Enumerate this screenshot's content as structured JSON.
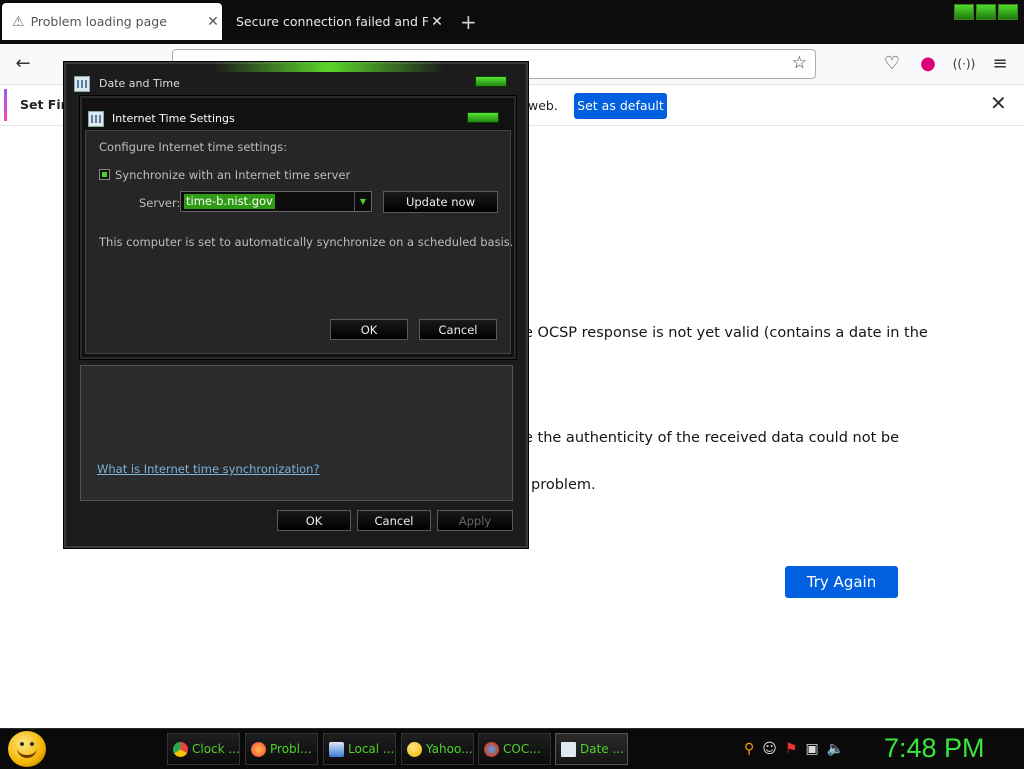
{
  "browser": {
    "tabs": [
      {
        "label": "Problem loading page",
        "active": true
      },
      {
        "label": "Secure connection failed and Firefo",
        "active": false
      }
    ],
    "new_tab_glyph": "+",
    "notification": {
      "text_start": "Set Fire",
      "text_end": "web.",
      "button": "Set as default"
    }
  },
  "error_page": {
    "line1": "e OCSP response is not yet valid (contains a date in the",
    "line2": "e the authenticity of the received data could not be",
    "line3": "problem.",
    "try_again": "Try Again"
  },
  "date_time_dialog": {
    "title": "Date and Time",
    "help_link": "What is Internet time synchronization?",
    "ok": "OK",
    "cancel": "Cancel",
    "apply": "Apply"
  },
  "internet_time_dialog": {
    "title": "Internet Time Settings",
    "configure_label": "Configure Internet time settings:",
    "sync_checkbox_label": "Synchronize with an Internet time server",
    "sync_checked": true,
    "server_label": "Server:",
    "server_value": "time-b.nist.gov",
    "update_now": "Update now",
    "status_text": "This computer is set to automatically synchronize on a scheduled basis.",
    "ok": "OK",
    "cancel": "Cancel"
  },
  "taskbar": {
    "items": [
      {
        "label": "Clock ...",
        "icon": "chrome-icon",
        "color": "#e8453c"
      },
      {
        "label": "Probl...",
        "icon": "firefox-icon",
        "color": "#ff7139"
      },
      {
        "label": "Local ...",
        "icon": "network-icon",
        "color": "#3a7bd5"
      },
      {
        "label": "Yahoo...",
        "icon": "smiley-icon",
        "color": "#f4c400"
      },
      {
        "label": "COC...",
        "icon": "browser-icon",
        "color": "#d04020"
      },
      {
        "label": "Date ...",
        "icon": "calendar-icon",
        "color": "#dfe7ef"
      }
    ],
    "clock": "7:48 PM"
  }
}
